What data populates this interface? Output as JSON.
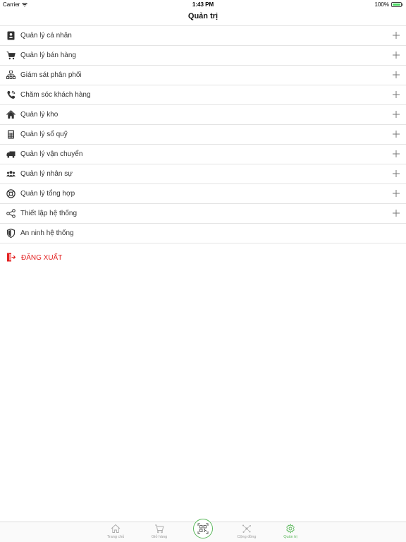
{
  "status_bar": {
    "carrier": "Carrier",
    "time": "1:43 PM",
    "battery": "100%",
    "battery_color": "#4cd964"
  },
  "nav": {
    "title": "Quản trị"
  },
  "menu": {
    "items": [
      {
        "label": "Quản lý cá nhân",
        "icon": "contact-book-icon"
      },
      {
        "label": "Quản lý bán hàng",
        "icon": "cart-icon"
      },
      {
        "label": "Giám sát phân phối",
        "icon": "sitemap-icon"
      },
      {
        "label": "Chăm sóc khách hàng",
        "icon": "phone-icon"
      },
      {
        "label": "Quản lý kho",
        "icon": "home-icon"
      },
      {
        "label": "Quản lý sổ quỹ",
        "icon": "calculator-icon"
      },
      {
        "label": "Quản lý vận chuyển",
        "icon": "truck-icon"
      },
      {
        "label": "Quản lý nhân sự",
        "icon": "users-icon"
      },
      {
        "label": "Quản lý tổng hợp",
        "icon": "life-ring-icon"
      },
      {
        "label": "Thiết lập hệ thống",
        "icon": "share-nodes-icon"
      },
      {
        "label": "An ninh hệ thống",
        "icon": "shield-icon"
      }
    ]
  },
  "logout": {
    "label": "ĐĂNG XUẤT",
    "color": "#e32222",
    "icon": "logout-door-icon"
  },
  "tabs": {
    "home": "Trang chủ",
    "cart": "Giỏ hàng",
    "community": "Cộng đồng",
    "admin": "Quản trị",
    "active_color": "#5cb85c"
  }
}
